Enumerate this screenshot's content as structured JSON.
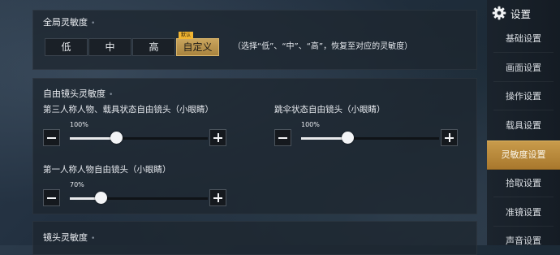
{
  "global": {
    "title": "全局灵敏度",
    "title_dot": "•",
    "presets": [
      {
        "label": "低"
      },
      {
        "label": "中"
      },
      {
        "label": "高"
      },
      {
        "label": "自定义",
        "badge": "默认",
        "active": true
      }
    ],
    "hint": "（选择“低”、“中”、“高”，恢复至对应的灵敏度）"
  },
  "free_camera": {
    "title": "自由镜头灵敏度",
    "title_dot": "•",
    "settings": [
      {
        "label": "第三人称人物、载具状态自由镜头（小眼睛）",
        "value_text": "100%",
        "value": 0.34
      },
      {
        "label": "跳伞状态自由镜头（小眼睛）",
        "value_text": "100%",
        "value": 0.34
      },
      {
        "label": "第一人称人物自由镜头（小眼睛）",
        "value_text": "70%",
        "value": 0.23
      }
    ]
  },
  "scope": {
    "title": "镜头灵敏度",
    "title_dot": "•"
  },
  "sidebar": {
    "header": "设置",
    "items": [
      {
        "label": "基础设置"
      },
      {
        "label": "画面设置"
      },
      {
        "label": "操作设置"
      },
      {
        "label": "载具设置"
      },
      {
        "label": "灵敏度设置",
        "active": true
      },
      {
        "label": "拾取设置"
      },
      {
        "label": "准镜设置"
      },
      {
        "label": "声音设置"
      }
    ]
  },
  "colors": {
    "accent": "#b98a3d",
    "panel": "#1e2630",
    "active_text": "#fbf6ea"
  }
}
